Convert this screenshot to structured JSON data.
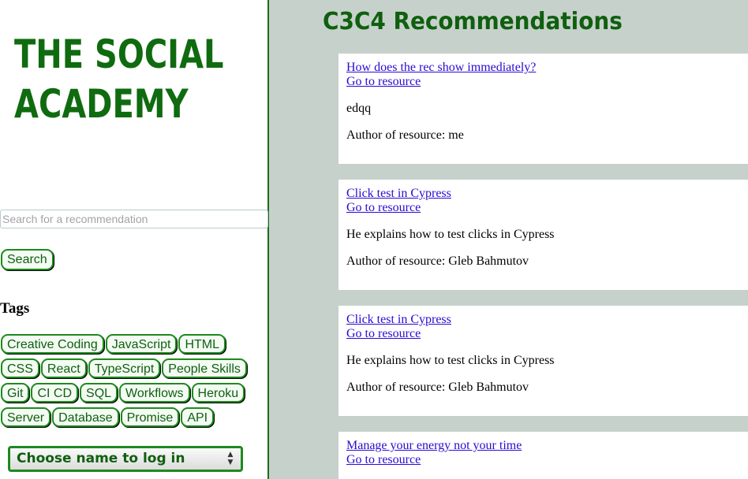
{
  "sidebar": {
    "logo_line1": "THE SOCIAL",
    "logo_line2": "ACADEMY",
    "search_placeholder": "Search for a recommendation",
    "search_value": "",
    "search_button": "Search",
    "tags_heading": "Tags",
    "tag_rows": [
      [
        "Creative Coding",
        "JavaScript",
        "HTML"
      ],
      [
        "CSS",
        "React",
        "TypeScript",
        "People Skills"
      ],
      [
        "Git",
        "CI CD",
        "SQL",
        "Workflows",
        "Heroku"
      ],
      [
        "Server",
        "Database",
        "Promise",
        "API"
      ]
    ],
    "login_select": "Choose name to log in"
  },
  "main": {
    "title": "C3C4 Recommendations",
    "recommendations": [
      {
        "title": "How does the rec show immediately?",
        "link": "Go to resource",
        "description": "edqq",
        "author": "Author of resource: me"
      },
      {
        "title": "Click test in Cypress",
        "link": "Go to resource",
        "description": "He explains how to test clicks in Cypress",
        "author": "Author of resource: Gleb Bahmutov"
      },
      {
        "title": "Click test in Cypress",
        "link": "Go to resource",
        "description": "He explains how to test clicks in Cypress",
        "author": "Author of resource: Gleb Bahmutov"
      },
      {
        "title": "Manage your energy not your time",
        "link": "Go to resource"
      }
    ]
  }
}
